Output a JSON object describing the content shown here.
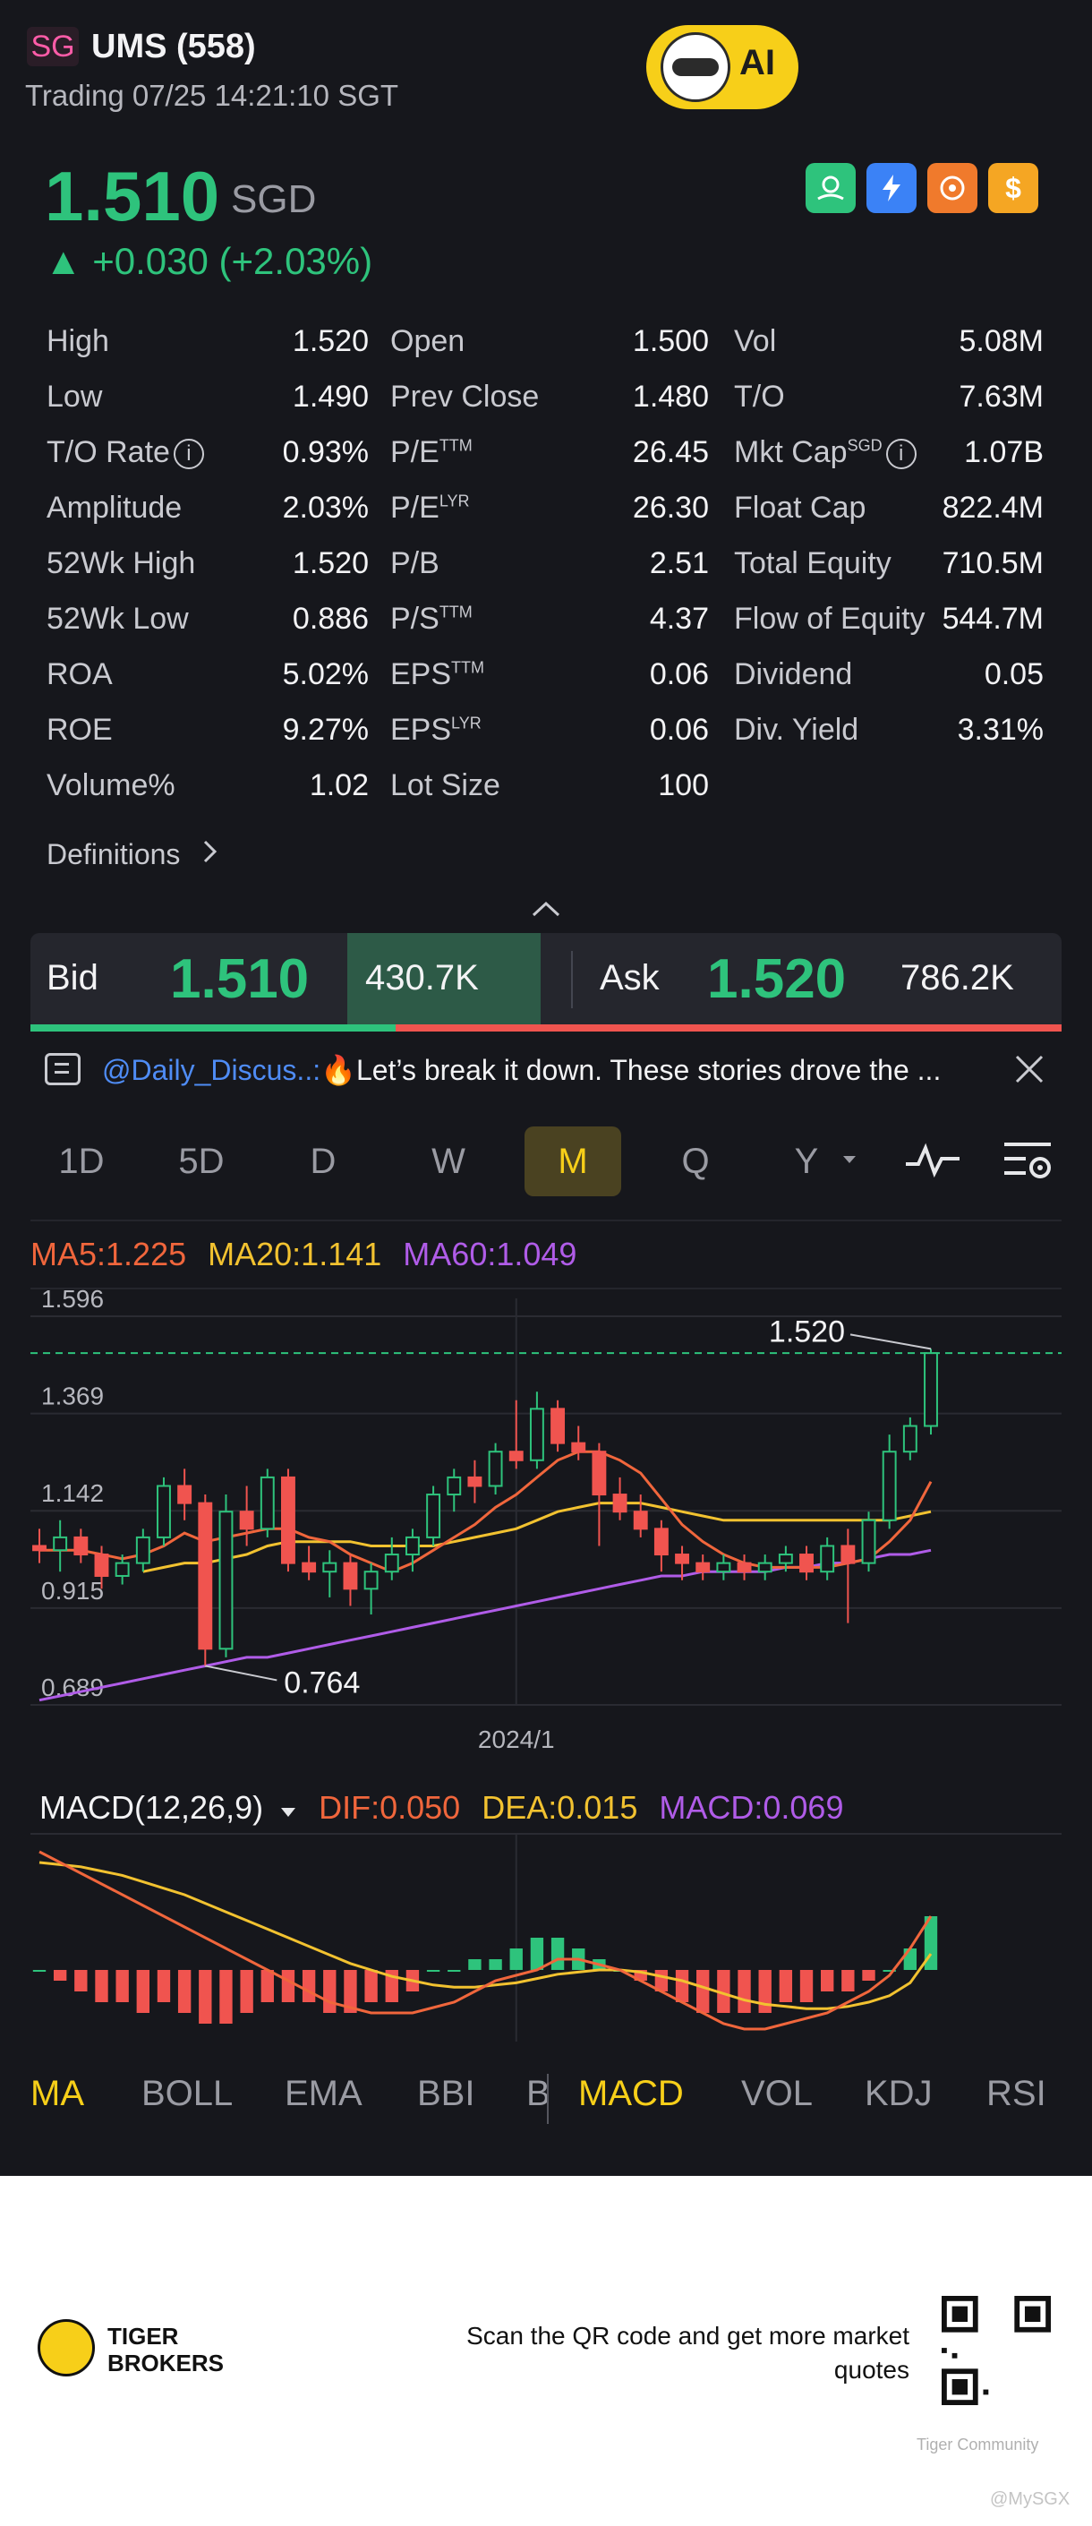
{
  "header": {
    "market_badge": "SG",
    "ticker": "UMS (558)",
    "trading_status": "Trading 07/25 14:21:10 SGT",
    "ai_label": "AI"
  },
  "quote": {
    "price": "1.510",
    "currency": "SGD",
    "change": "▲ +0.030 (+2.03%)"
  },
  "toolbar_icons": [
    {
      "name": "wealth-icon",
      "color": "#2ec37c"
    },
    {
      "name": "lightning-icon",
      "color": "#3b82f6"
    },
    {
      "name": "orbit-icon",
      "color": "#f07a2c"
    },
    {
      "name": "dollar-icon",
      "color": "#f5a623"
    }
  ],
  "stats": [
    [
      {
        "label": "High",
        "value": "1.520"
      },
      {
        "label": "Open",
        "value": "1.500"
      },
      {
        "label": "Vol",
        "value": "5.08M"
      }
    ],
    [
      {
        "label": "Low",
        "value": "1.490"
      },
      {
        "label": "Prev Close",
        "value": "1.480"
      },
      {
        "label": "T/O",
        "value": "7.63M"
      }
    ],
    [
      {
        "label": "T/O Rate",
        "value": "0.93%",
        "info": true
      },
      {
        "label": "P/E",
        "sup": "TTM",
        "value": "26.45"
      },
      {
        "label": "Mkt Cap",
        "sup": "SGD",
        "value": "1.07B",
        "info": true
      }
    ],
    [
      {
        "label": "Amplitude",
        "value": "2.03%"
      },
      {
        "label": "P/E",
        "sup": "LYR",
        "value": "26.30"
      },
      {
        "label": "Float Cap",
        "value": "822.4M"
      }
    ],
    [
      {
        "label": "52Wk High",
        "value": "1.520"
      },
      {
        "label": "P/B",
        "value": "2.51"
      },
      {
        "label": "Total Equity",
        "value": "710.5M"
      }
    ],
    [
      {
        "label": "52Wk Low",
        "value": "0.886"
      },
      {
        "label": "P/S",
        "sup": "TTM",
        "value": "4.37"
      },
      {
        "label": "Flow of Equity",
        "value": "544.7M"
      }
    ],
    [
      {
        "label": "ROA",
        "value": "5.02%"
      },
      {
        "label": "EPS",
        "sup": "TTM",
        "value": "0.06"
      },
      {
        "label": "Dividend",
        "value": "0.05"
      }
    ],
    [
      {
        "label": "ROE",
        "value": "9.27%"
      },
      {
        "label": "EPS",
        "sup": "LYR",
        "value": "0.06"
      },
      {
        "label": "Div. Yield",
        "value": "3.31%"
      }
    ],
    [
      {
        "label": "Volume%",
        "value": "1.02"
      },
      {
        "label": "Lot Size",
        "value": "100"
      }
    ]
  ],
  "definitions_label": "Definitions",
  "bid_ask": {
    "bid_label": "Bid",
    "bid_price": "1.510",
    "bid_size": "430.7K",
    "ask_label": "Ask",
    "ask_price": "1.520",
    "ask_size": "786.2K",
    "bid_ratio": 0.354
  },
  "news": {
    "user": "@Daily_Discus..:",
    "text": "🔥Let’s break it down. These stories drove the ..."
  },
  "periods": [
    "1D",
    "5D",
    "D",
    "W",
    "M",
    "Q",
    "Y"
  ],
  "active_period": "M",
  "ma_legend": [
    {
      "text": "MA5:1.225",
      "color": "#f0663c"
    },
    {
      "text": "MA20:1.141",
      "color": "#f2c230"
    },
    {
      "text": "MA60:1.049",
      "color": "#b05ce8"
    }
  ],
  "macd_legend": {
    "title": "MACD(12,26,9)",
    "items": [
      {
        "text": "DIF:0.050",
        "color": "#f0663c"
      },
      {
        "text": "DEA:0.015",
        "color": "#f2c230"
      },
      {
        "text": "MACD:0.069",
        "color": "#b05ce8"
      }
    ]
  },
  "indicator_tabs": [
    "MA",
    "BOLL",
    "EMA",
    "BBI",
    "B",
    "MACD",
    "VOL",
    "KDJ",
    "RSI"
  ],
  "active_indicators": [
    "MA",
    "MACD"
  ],
  "chart_data": {
    "type": "candlestick",
    "y_ticks": [
      "1.596",
      "1.369",
      "1.142",
      "0.915",
      "0.689"
    ],
    "ylim": [
      0.689,
      1.596
    ],
    "x_tick_label": "2024/1",
    "x_tick_index": 23,
    "high_label": "1.520",
    "low_label": "0.764",
    "reference_line": 1.51,
    "candles": [
      {
        "o": 1.06,
        "h": 1.1,
        "l": 1.02,
        "c": 1.05
      },
      {
        "o": 1.05,
        "h": 1.12,
        "l": 1.0,
        "c": 1.08
      },
      {
        "o": 1.08,
        "h": 1.1,
        "l": 1.02,
        "c": 1.04
      },
      {
        "o": 1.04,
        "h": 1.06,
        "l": 0.96,
        "c": 0.99
      },
      {
        "o": 0.99,
        "h": 1.04,
        "l": 0.97,
        "c": 1.02
      },
      {
        "o": 1.02,
        "h": 1.1,
        "l": 1.0,
        "c": 1.08
      },
      {
        "o": 1.08,
        "h": 1.22,
        "l": 1.06,
        "c": 1.2
      },
      {
        "o": 1.2,
        "h": 1.24,
        "l": 1.12,
        "c": 1.16
      },
      {
        "o": 1.16,
        "h": 1.18,
        "l": 0.78,
        "c": 0.82
      },
      {
        "o": 0.82,
        "h": 1.18,
        "l": 0.8,
        "c": 1.14
      },
      {
        "o": 1.14,
        "h": 1.2,
        "l": 1.06,
        "c": 1.1
      },
      {
        "o": 1.1,
        "h": 1.24,
        "l": 1.08,
        "c": 1.22
      },
      {
        "o": 1.22,
        "h": 1.24,
        "l": 1.0,
        "c": 1.02
      },
      {
        "o": 1.02,
        "h": 1.06,
        "l": 0.98,
        "c": 1.0
      },
      {
        "o": 1.0,
        "h": 1.05,
        "l": 0.94,
        "c": 1.02
      },
      {
        "o": 1.02,
        "h": 1.04,
        "l": 0.92,
        "c": 0.96
      },
      {
        "o": 0.96,
        "h": 1.02,
        "l": 0.9,
        "c": 1.0
      },
      {
        "o": 1.0,
        "h": 1.08,
        "l": 0.98,
        "c": 1.04
      },
      {
        "o": 1.04,
        "h": 1.1,
        "l": 1.0,
        "c": 1.08
      },
      {
        "o": 1.08,
        "h": 1.2,
        "l": 1.06,
        "c": 1.18
      },
      {
        "o": 1.18,
        "h": 1.24,
        "l": 1.14,
        "c": 1.22
      },
      {
        "o": 1.22,
        "h": 1.26,
        "l": 1.16,
        "c": 1.2
      },
      {
        "o": 1.2,
        "h": 1.3,
        "l": 1.18,
        "c": 1.28
      },
      {
        "o": 1.28,
        "h": 1.4,
        "l": 1.24,
        "c": 1.26
      },
      {
        "o": 1.26,
        "h": 1.42,
        "l": 1.24,
        "c": 1.38
      },
      {
        "o": 1.38,
        "h": 1.4,
        "l": 1.28,
        "c": 1.3
      },
      {
        "o": 1.3,
        "h": 1.34,
        "l": 1.26,
        "c": 1.28
      },
      {
        "o": 1.28,
        "h": 1.3,
        "l": 1.06,
        "c": 1.18
      },
      {
        "o": 1.18,
        "h": 1.22,
        "l": 1.12,
        "c": 1.14
      },
      {
        "o": 1.14,
        "h": 1.18,
        "l": 1.08,
        "c": 1.1
      },
      {
        "o": 1.1,
        "h": 1.12,
        "l": 1.0,
        "c": 1.04
      },
      {
        "o": 1.04,
        "h": 1.06,
        "l": 0.98,
        "c": 1.02
      },
      {
        "o": 1.02,
        "h": 1.04,
        "l": 0.98,
        "c": 1.0
      },
      {
        "o": 1.0,
        "h": 1.04,
        "l": 0.98,
        "c": 1.02
      },
      {
        "o": 1.02,
        "h": 1.04,
        "l": 0.98,
        "c": 1.0
      },
      {
        "o": 1.0,
        "h": 1.04,
        "l": 0.98,
        "c": 1.02
      },
      {
        "o": 1.02,
        "h": 1.06,
        "l": 1.0,
        "c": 1.04
      },
      {
        "o": 1.04,
        "h": 1.06,
        "l": 0.98,
        "c": 1.0
      },
      {
        "o": 1.0,
        "h": 1.08,
        "l": 0.98,
        "c": 1.06
      },
      {
        "o": 1.06,
        "h": 1.1,
        "l": 0.88,
        "c": 1.02
      },
      {
        "o": 1.02,
        "h": 1.14,
        "l": 1.0,
        "c": 1.12
      },
      {
        "o": 1.12,
        "h": 1.32,
        "l": 1.1,
        "c": 1.28
      },
      {
        "o": 1.28,
        "h": 1.36,
        "l": 1.26,
        "c": 1.34
      },
      {
        "o": 1.34,
        "h": 1.52,
        "l": 1.32,
        "c": 1.51
      }
    ],
    "ma5": [
      1.05,
      1.05,
      1.05,
      1.04,
      1.03,
      1.04,
      1.06,
      1.09,
      1.07,
      1.08,
      1.09,
      1.1,
      1.1,
      1.08,
      1.07,
      1.04,
      1.02,
      1.0,
      1.02,
      1.05,
      1.08,
      1.11,
      1.15,
      1.18,
      1.22,
      1.26,
      1.28,
      1.28,
      1.26,
      1.23,
      1.17,
      1.11,
      1.07,
      1.04,
      1.02,
      1.01,
      1.01,
      1.01,
      1.01,
      1.02,
      1.03,
      1.07,
      1.12,
      1.21
    ],
    "ma20": [
      null,
      null,
      null,
      null,
      null,
      1.0,
      1.01,
      1.02,
      1.02,
      1.03,
      1.04,
      1.06,
      1.07,
      1.07,
      1.07,
      1.07,
      1.06,
      1.06,
      1.06,
      1.06,
      1.07,
      1.08,
      1.09,
      1.1,
      1.12,
      1.14,
      1.15,
      1.16,
      1.16,
      1.16,
      1.15,
      1.14,
      1.13,
      1.12,
      1.12,
      1.12,
      1.12,
      1.12,
      1.12,
      1.12,
      1.12,
      1.12,
      1.13,
      1.14
    ],
    "ma60": [
      0.7,
      0.71,
      0.72,
      0.73,
      0.74,
      0.75,
      0.76,
      0.77,
      0.78,
      0.79,
      0.8,
      0.8,
      0.81,
      0.82,
      0.83,
      0.84,
      0.85,
      0.86,
      0.87,
      0.88,
      0.89,
      0.9,
      0.91,
      0.92,
      0.93,
      0.94,
      0.95,
      0.96,
      0.97,
      0.98,
      0.99,
      0.99,
      1.0,
      1.0,
      1.0,
      1.0,
      1.01,
      1.01,
      1.02,
      1.02,
      1.03,
      1.04,
      1.04,
      1.05
    ],
    "macd_hist": [
      0.0,
      -0.01,
      -0.02,
      -0.03,
      -0.03,
      -0.04,
      -0.03,
      -0.04,
      -0.05,
      -0.05,
      -0.04,
      -0.03,
      -0.03,
      -0.03,
      -0.04,
      -0.04,
      -0.03,
      -0.03,
      -0.02,
      0.0,
      0.0,
      0.01,
      0.01,
      0.02,
      0.03,
      0.03,
      0.02,
      0.01,
      0.0,
      -0.01,
      -0.02,
      -0.03,
      -0.04,
      -0.04,
      -0.04,
      -0.04,
      -0.03,
      -0.03,
      -0.02,
      -0.02,
      -0.01,
      0.0,
      0.02,
      0.05
    ],
    "dif": [
      0.11,
      0.1,
      0.09,
      0.08,
      0.07,
      0.06,
      0.05,
      0.04,
      0.03,
      0.02,
      0.01,
      0.0,
      -0.01,
      -0.02,
      -0.03,
      -0.035,
      -0.04,
      -0.04,
      -0.04,
      -0.035,
      -0.03,
      -0.02,
      -0.01,
      -0.005,
      0.0,
      0.01,
      0.01,
      0.005,
      0.0,
      -0.01,
      -0.02,
      -0.03,
      -0.04,
      -0.05,
      -0.055,
      -0.055,
      -0.05,
      -0.045,
      -0.04,
      -0.03,
      -0.02,
      -0.005,
      0.02,
      0.05
    ],
    "dea": [
      0.1,
      0.098,
      0.096,
      0.092,
      0.088,
      0.082,
      0.076,
      0.07,
      0.062,
      0.054,
      0.046,
      0.038,
      0.03,
      0.022,
      0.014,
      0.006,
      0.0,
      -0.006,
      -0.01,
      -0.014,
      -0.016,
      -0.016,
      -0.014,
      -0.012,
      -0.008,
      -0.004,
      -0.002,
      0.0,
      0.0,
      -0.002,
      -0.006,
      -0.01,
      -0.016,
      -0.022,
      -0.028,
      -0.032,
      -0.034,
      -0.036,
      -0.036,
      -0.034,
      -0.03,
      -0.024,
      -0.012,
      0.015
    ],
    "colors": {
      "up": "#2ec37c",
      "down": "#f0544f"
    }
  },
  "footer": {
    "brand": "TIGER\nBROKERS",
    "brand_line1": "TIGER",
    "brand_line2": "BROKERS",
    "scan_text": "Scan the QR code and get more market quotes",
    "watermark": "Tiger Community",
    "watermark2": "@MySGX"
  }
}
